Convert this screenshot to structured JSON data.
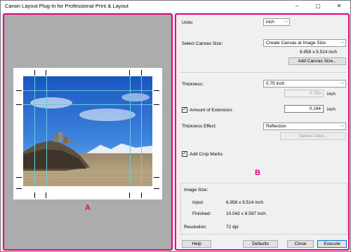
{
  "window": {
    "title": "Canon Layout Plug-In for Professional Print & Layout"
  },
  "titlebar_buttons": {
    "minimize": "–",
    "maximize": "▢",
    "close": "✕"
  },
  "preview": {
    "marker": "A"
  },
  "settings": {
    "marker": "B",
    "units": {
      "label": "Units:",
      "value": "inch"
    },
    "canvas": {
      "label": "Select Canvas Size:",
      "value": "Create Canvas at Image Size",
      "size_text": "6.958 x 5.514 inch",
      "add_button": "Add Canvas Size..."
    },
    "thickness": {
      "label": "Thickness:",
      "value": "0.75 inch",
      "field_value": "0.750",
      "unit": "inch"
    },
    "extension": {
      "label": "Amount of Extension:",
      "checked": true,
      "value": "0.194",
      "unit": "inch"
    },
    "effect": {
      "label": "Thickness Effect:",
      "value": "Reflection",
      "color_button": "Select Color..."
    },
    "crop": {
      "label": "Add Crop Marks",
      "checked": true
    },
    "image_size": {
      "heading": "Image Size:",
      "input_label": "Input:",
      "input_value": "6.958 x 5.514 inch",
      "finished_label": "Finished:",
      "finished_value": "10.042 x 8.597 inch",
      "resolution_label": "Resolution:",
      "resolution_value": "72 dpi"
    }
  },
  "footer": {
    "help": "Help",
    "defaults": "Defaults",
    "close": "Close",
    "execute": "Execute"
  },
  "colors": {
    "marker": "#e4007f",
    "guide": "#66ccdd",
    "preview_bg": "#acacac"
  },
  "icons": {
    "dropdown": "chevron-down-icon",
    "checkmark": "checkmark-icon"
  }
}
